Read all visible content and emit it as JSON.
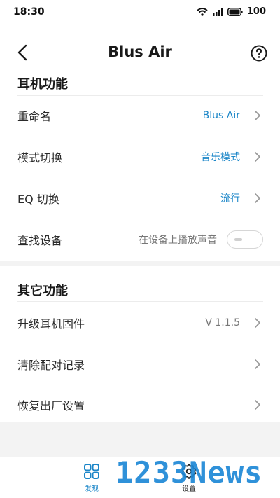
{
  "status_bar": {
    "time": "18:30",
    "battery": "100",
    "icons": [
      "wifi-icon",
      "signal-icon",
      "battery-icon"
    ]
  },
  "nav": {
    "title": "Blus Air",
    "back_icon": "chevron-left-icon",
    "help_icon": "help-circle-icon"
  },
  "section_earphone": {
    "title": "耳机功能",
    "items": [
      {
        "label": "重命名",
        "value": "Blus Air"
      },
      {
        "label": "模式切换",
        "value": "音乐模式"
      },
      {
        "label": "EQ 切换",
        "value": "流行"
      },
      {
        "label": "查找设备",
        "value": "在设备上播放声音",
        "toggle_on": false
      }
    ]
  },
  "section_other": {
    "title": "其它功能",
    "items": [
      {
        "label": "升级耳机固件",
        "value": "V 1.1.5"
      },
      {
        "label": "清除配对记录"
      },
      {
        "label": "恢复出厂设置"
      }
    ]
  },
  "tabbar": {
    "tabs": [
      {
        "label": "发现",
        "icon": "grid-icon",
        "active": true
      },
      {
        "label": "设置",
        "icon": "gear-icon",
        "active": false
      }
    ]
  },
  "watermark": "1233News",
  "colors": {
    "accent": "#1b86c8",
    "background": "#f3f3f3",
    "card": "#ffffff"
  }
}
